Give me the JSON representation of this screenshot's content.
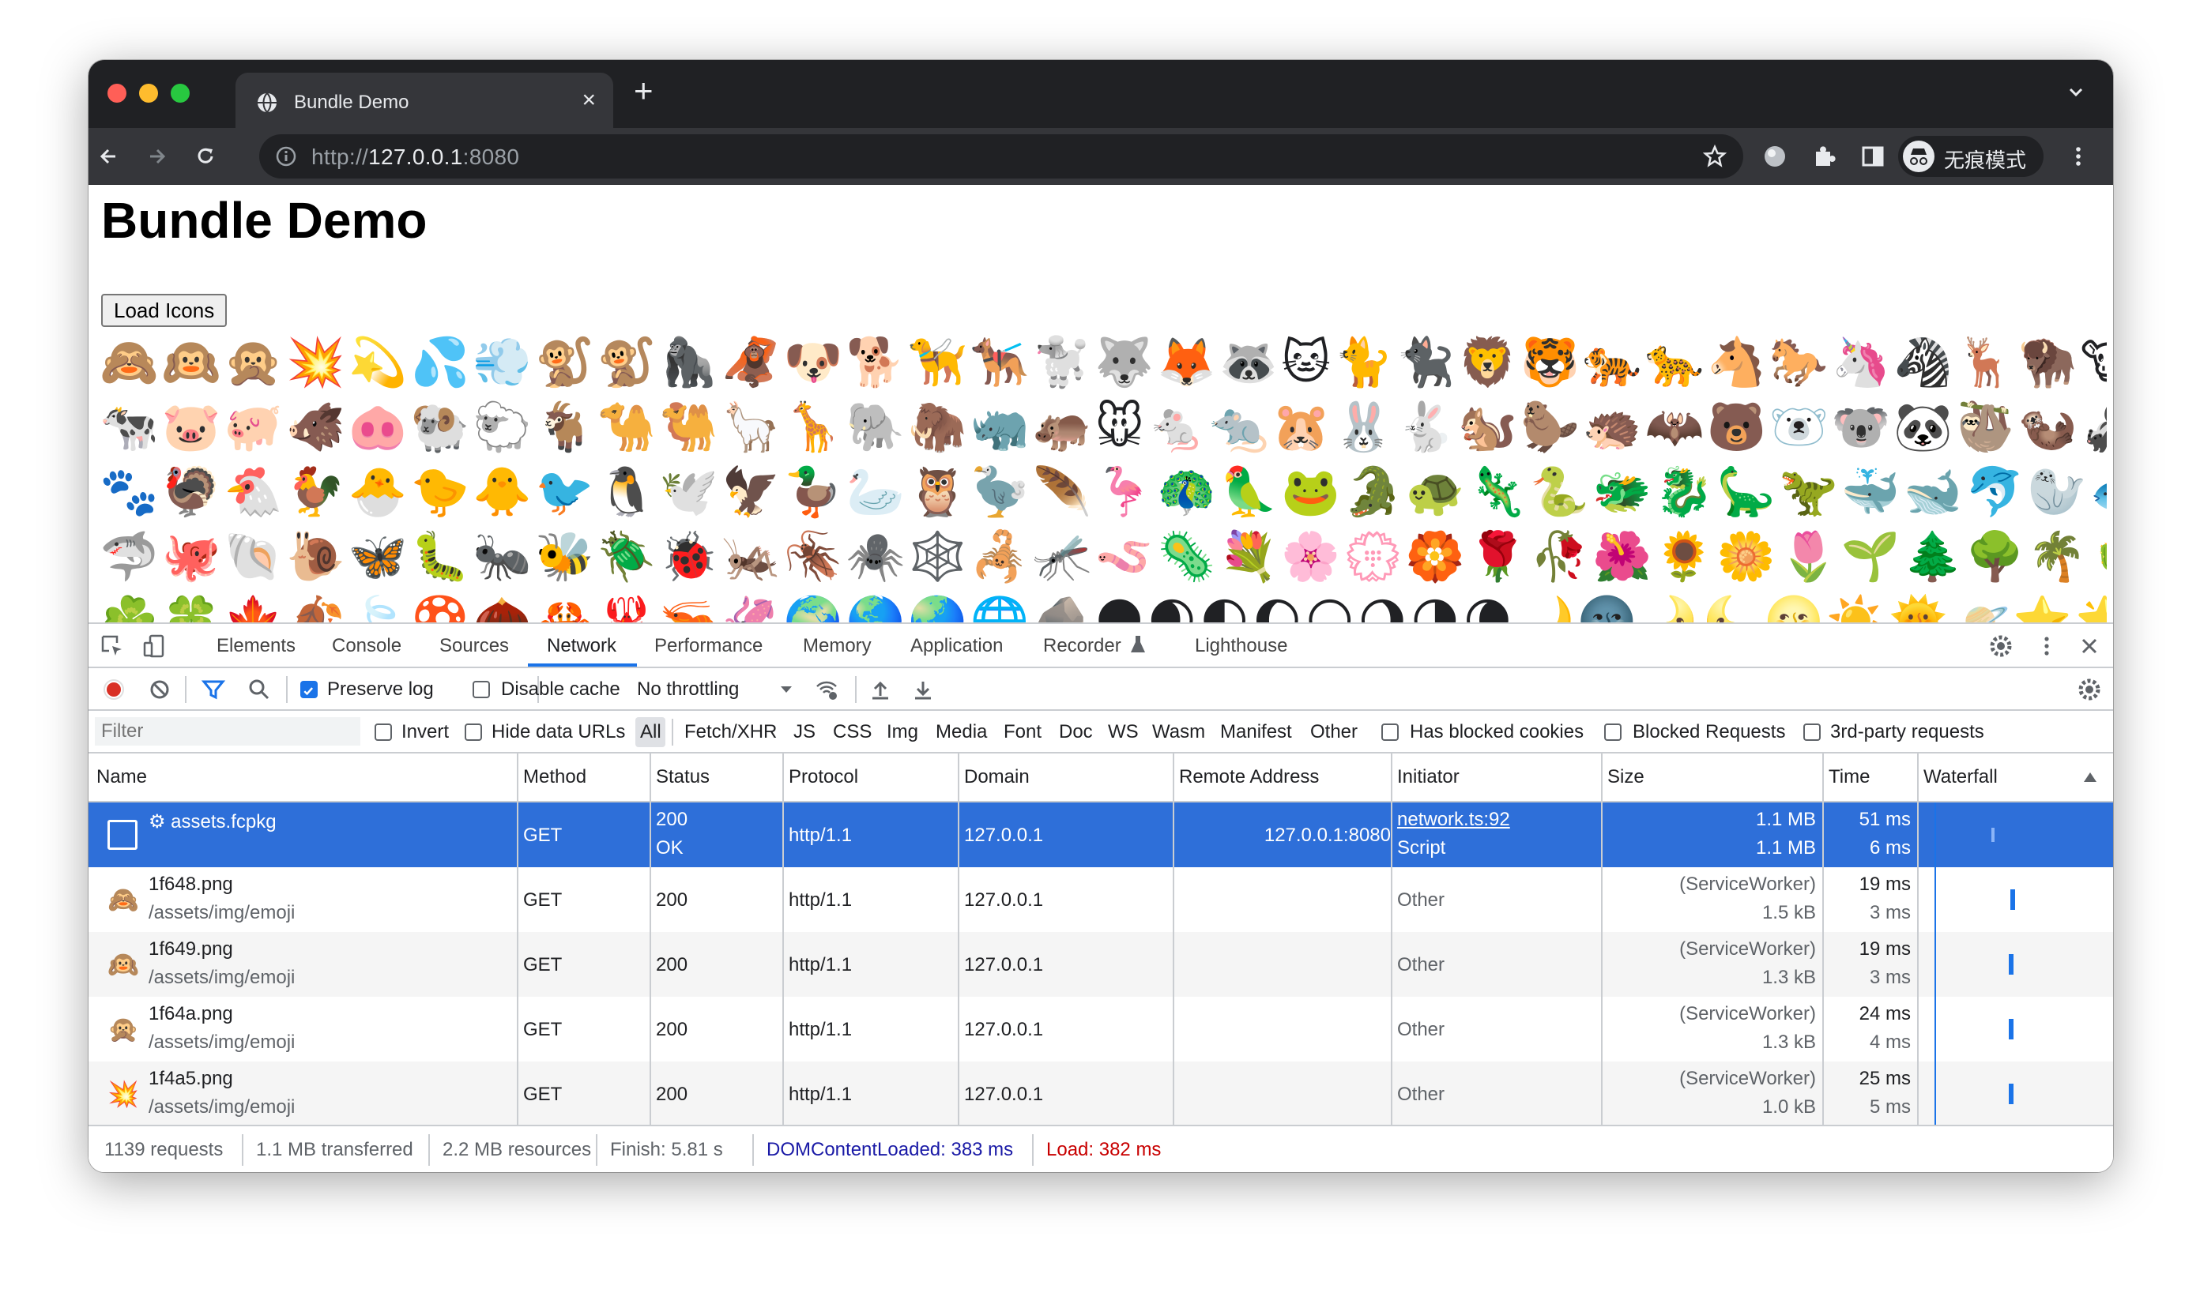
{
  "browser": {
    "tab_title": "Bundle Demo",
    "tab_close": "×",
    "new_tab": "+",
    "url_prefix": "http://",
    "url_host": "127.0.0.1",
    "url_port": ":8080",
    "profile_label": "无痕模式",
    "traffic_lights": [
      "#ff5f57",
      "#febc2e",
      "#28c840"
    ]
  },
  "page": {
    "title": "Bundle Demo",
    "load_button": "Load Icons",
    "emoji_rows": [
      "🙈🙉🙊💥💫💦💨🐒🐒🦍🦧🐶🐕🦮🐕‍🦺🐩🐺🦊🦝🐱🐈🐈‍⬛🦁🐯🐅🐆🐴🐎🦄🦓🦌🦬🐮🐂🐃",
      "🐄🐷🐖🐗🐽🐏🐑🐐🐪🐫🦙🦒🐘🦣🦏🦛🐭🐁🐀🐹🐰🐇🐿️🦫🦔🦇🐻🐻‍❄️🐨🐼🦥🦦🦨🦘🦡",
      "🐾🦃🐔🐓🐣🐤🐥🐦🐧🕊️🦅🦆🦢🦉🦤🪶🦩🦚🦜🐸🐊🐢🦎🐍🐲🐉🦕🦖🐳🐋🐬🦭🐟🐠🐡",
      "🦈🐙🐚🐌🦋🐛🐜🐝🪲🐞🦗🪳🕷️🕸️🦂🦟🪱🦠💐🌸💮🏵️🌹🥀🌺🌻🌼🌷🌱🌲🌳🌴🌵🌾🌿",
      "☘️🍀🍁🍂🍃🍄🌰🦀🦞🦐🦑🌍🌎🌏🌐🪨🌑🌒🌓🌔🌕🌖🌗🌘🌙🌚🌛🌜🌝☀️🌞🪐⭐🌟🌠☁️"
    ]
  },
  "devtools": {
    "tabs": [
      "Elements",
      "Console",
      "Sources",
      "Network",
      "Performance",
      "Memory",
      "Application",
      "Recorder",
      "Lighthouse"
    ],
    "active_tab": "Network",
    "preserve_log": "Preserve log",
    "disable_cache": "Disable cache",
    "throttling": "No throttling",
    "filter_placeholder": "Filter",
    "invert": "Invert",
    "hide_data_urls": "Hide data URLs",
    "types": [
      "All",
      "Fetch/XHR",
      "JS",
      "CSS",
      "Img",
      "Media",
      "Font",
      "Doc",
      "WS",
      "Wasm",
      "Manifest",
      "Other"
    ],
    "has_blocked_cookies": "Has blocked cookies",
    "blocked_requests": "Blocked Requests",
    "third_party": "3rd-party requests",
    "columns": [
      "Name",
      "Method",
      "Status",
      "Protocol",
      "Domain",
      "Remote Address",
      "Initiator",
      "Size",
      "Time",
      "Waterfall"
    ],
    "rows": [
      {
        "icon": "⚙",
        "name": "⚙ assets.fcpkg",
        "path": "",
        "method": "GET",
        "status": "200",
        "status_text": "OK",
        "protocol": "http/1.1",
        "domain": "127.0.0.1",
        "remote": "127.0.0.1:8080",
        "initiator": "network.ts:92",
        "initiator_type": "Script",
        "size": "1.1 MB",
        "size2": "1.1 MB",
        "time": "51 ms",
        "time2": "6 ms"
      },
      {
        "icon": "🙈",
        "name": "1f648.png",
        "path": "/assets/img/emoji",
        "method": "GET",
        "status": "200",
        "status_text": "",
        "protocol": "http/1.1",
        "domain": "127.0.0.1",
        "remote": "",
        "initiator": "Other",
        "initiator_type": "",
        "size": "(ServiceWorker)",
        "size2": "1.5 kB",
        "time": "19 ms",
        "time2": "3 ms"
      },
      {
        "icon": "🙉",
        "name": "1f649.png",
        "path": "/assets/img/emoji",
        "method": "GET",
        "status": "200",
        "status_text": "",
        "protocol": "http/1.1",
        "domain": "127.0.0.1",
        "remote": "",
        "initiator": "Other",
        "initiator_type": "",
        "size": "(ServiceWorker)",
        "size2": "1.3 kB",
        "time": "19 ms",
        "time2": "3 ms"
      },
      {
        "icon": "🙊",
        "name": "1f64a.png",
        "path": "/assets/img/emoji",
        "method": "GET",
        "status": "200",
        "status_text": "",
        "protocol": "http/1.1",
        "domain": "127.0.0.1",
        "remote": "",
        "initiator": "Other",
        "initiator_type": "",
        "size": "(ServiceWorker)",
        "size2": "1.3 kB",
        "time": "24 ms",
        "time2": "4 ms"
      },
      {
        "icon": "💥",
        "name": "1f4a5.png",
        "path": "/assets/img/emoji",
        "method": "GET",
        "status": "200",
        "status_text": "",
        "protocol": "http/1.1",
        "domain": "127.0.0.1",
        "remote": "",
        "initiator": "Other",
        "initiator_type": "",
        "size": "(ServiceWorker)",
        "size2": "1.0 kB",
        "time": "25 ms",
        "time2": "5 ms"
      }
    ],
    "status_bar": {
      "requests": "1139 requests",
      "transferred": "1.1 MB transferred",
      "resources": "2.2 MB resources",
      "finish": "Finish: 5.81 s",
      "dcl": "DOMContentLoaded: 383 ms",
      "load": "Load: 382 ms"
    },
    "colors": {
      "accent": "#1a73e8",
      "selected_row": "#2e6fd9",
      "dcl": "#1a1aa6",
      "load": "#c80000"
    }
  }
}
